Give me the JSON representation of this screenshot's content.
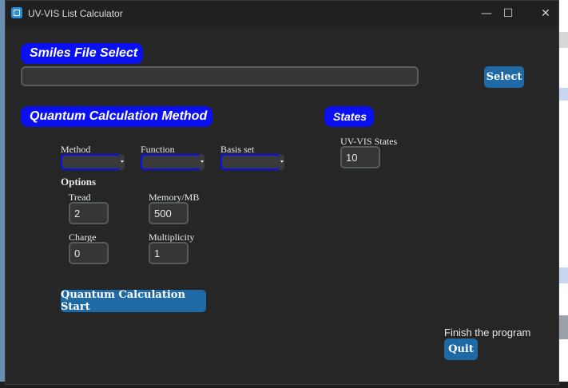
{
  "window": {
    "title": "UV-VIS List Calculator",
    "minimize_glyph": "—",
    "maximize_glyph": "☐",
    "close_glyph": "✕"
  },
  "smiles": {
    "label": "Smiles File Select",
    "path_value": "",
    "select_label": "Select"
  },
  "quantum": {
    "label": "Quantum Calculation Method",
    "method_label": "Method",
    "function_label": "Function",
    "basis_label": "Basis set",
    "options_label": "Options",
    "tread_label": "Tread",
    "tread_value": "2",
    "memory_label": "Memory/MB",
    "memory_value": "500",
    "charge_label": "Charge",
    "charge_value": "0",
    "multiplicity_label": "Multiplicity",
    "multiplicity_value": "1",
    "start_label": "Quantum Calculation Start"
  },
  "states": {
    "label": "States",
    "uvvis_label": "UV-VIS States",
    "uvvis_value": "10"
  },
  "finish": {
    "label": "Finish the program",
    "quit_label": "Quit"
  },
  "colors": {
    "section_label_bg": "#0a10f0",
    "button_bg": "#1f6aa5",
    "window_bg": "#262626"
  }
}
